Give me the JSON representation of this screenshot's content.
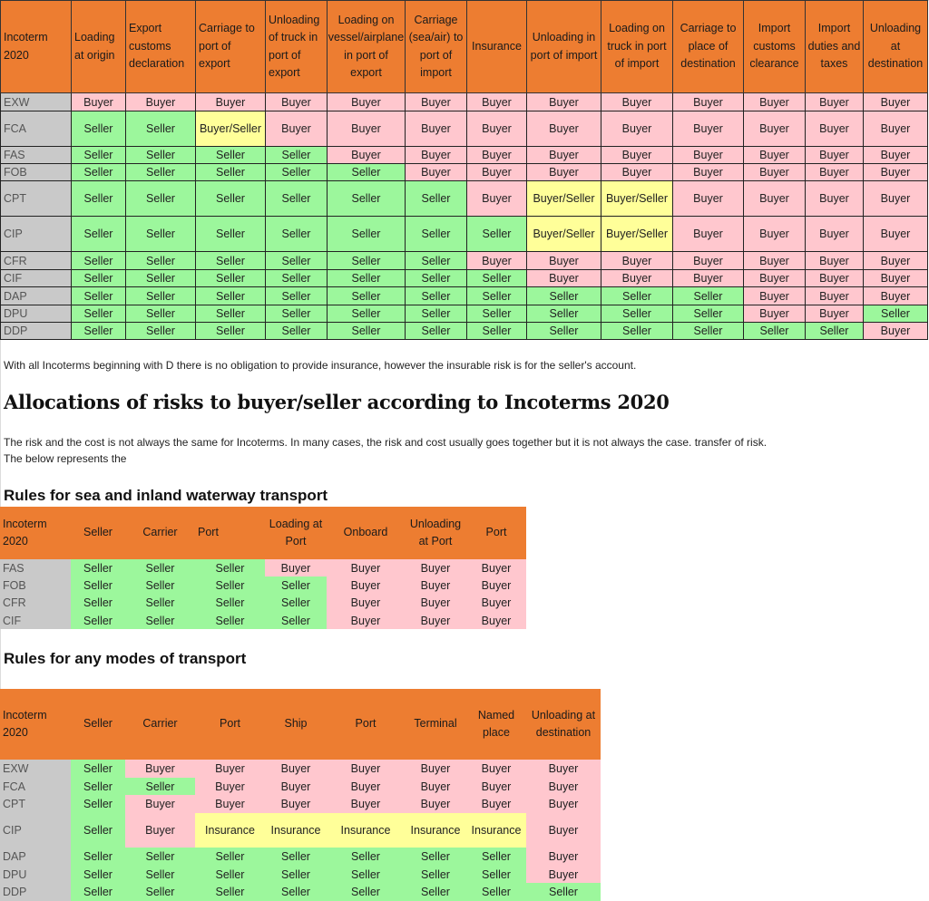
{
  "cost_table": {
    "headers": [
      "Incoterm 2020",
      "Loading at origin",
      "Export customs declaration",
      "Carriage to port of export",
      "Unloading of truck in port of export",
      "Loading on vessel/airplane in port of export",
      "Carriage (sea/air) to port of import",
      "Insurance",
      "Unloading in port of import",
      "Loading on truck in port of import",
      "Carriage to place of destination",
      "Import customs clearance",
      "Import duties and taxes",
      "Unloading at destination"
    ],
    "rows": [
      {
        "term": "EXW",
        "cells": [
          "Buyer",
          "Buyer",
          "Buyer",
          "Buyer",
          "Buyer",
          "Buyer",
          "Buyer",
          "Buyer",
          "Buyer",
          "Buyer",
          "Buyer",
          "Buyer",
          "Buyer"
        ]
      },
      {
        "term": "FCA",
        "cells": [
          "Seller",
          "Seller",
          "Buyer/Seller",
          "Buyer",
          "Buyer",
          "Buyer",
          "Buyer",
          "Buyer",
          "Buyer",
          "Buyer",
          "Buyer",
          "Buyer",
          "Buyer"
        ]
      },
      {
        "term": "FAS",
        "cells": [
          "Seller",
          "Seller",
          "Seller",
          "Seller",
          "Buyer",
          "Buyer",
          "Buyer",
          "Buyer",
          "Buyer",
          "Buyer",
          "Buyer",
          "Buyer",
          "Buyer"
        ]
      },
      {
        "term": "FOB",
        "cells": [
          "Seller",
          "Seller",
          "Seller",
          "Seller",
          "Seller",
          "Buyer",
          "Buyer",
          "Buyer",
          "Buyer",
          "Buyer",
          "Buyer",
          "Buyer",
          "Buyer"
        ]
      },
      {
        "term": "CPT",
        "cells": [
          "Seller",
          "Seller",
          "Seller",
          "Seller",
          "Seller",
          "Seller",
          "Buyer",
          "Buyer/Seller",
          "Buyer/Seller",
          "Buyer",
          "Buyer",
          "Buyer",
          "Buyer"
        ]
      },
      {
        "term": "CIP",
        "cells": [
          "Seller",
          "Seller",
          "Seller",
          "Seller",
          "Seller",
          "Seller",
          "Seller",
          "Buyer/Seller",
          "Buyer/Seller",
          "Buyer",
          "Buyer",
          "Buyer",
          "Buyer"
        ]
      },
      {
        "term": "CFR",
        "cells": [
          "Seller",
          "Seller",
          "Seller",
          "Seller",
          "Seller",
          "Seller",
          "Buyer",
          "Buyer",
          "Buyer",
          "Buyer",
          "Buyer",
          "Buyer",
          "Buyer"
        ]
      },
      {
        "term": "CIF",
        "cells": [
          "Seller",
          "Seller",
          "Seller",
          "Seller",
          "Seller",
          "Seller",
          "Seller",
          "Buyer",
          "Buyer",
          "Buyer",
          "Buyer",
          "Buyer",
          "Buyer"
        ]
      },
      {
        "term": "DAP",
        "cells": [
          "Seller",
          "Seller",
          "Seller",
          "Seller",
          "Seller",
          "Seller",
          "Seller",
          "Seller",
          "Seller",
          "Seller",
          "Buyer",
          "Buyer",
          "Buyer"
        ]
      },
      {
        "term": "DPU",
        "cells": [
          "Seller",
          "Seller",
          "Seller",
          "Seller",
          "Seller",
          "Seller",
          "Seller",
          "Seller",
          "Seller",
          "Seller",
          "Buyer",
          "Buyer",
          "Seller"
        ]
      },
      {
        "term": "DDP",
        "cells": [
          "Seller",
          "Seller",
          "Seller",
          "Seller",
          "Seller",
          "Seller",
          "Seller",
          "Seller",
          "Seller",
          "Seller",
          "Seller",
          "Seller",
          "Buyer"
        ]
      }
    ]
  },
  "notes": {
    "insurance_note": "With all Incoterms beginning with D there is no obligation to provide insurance, however the insurable risk is for the seller's account.",
    "risk_title": "Allocations of risks to buyer/seller according to Incoterms 2020",
    "risk_intro_1": "The risk and the cost is not always the same for Incoterms. In many cases, the risk and cost usually goes together but it is not always the case. transfer of risk.",
    "risk_intro_2": "The below represents the"
  },
  "sea_table": {
    "title": "Rules for sea and inland waterway transport",
    "headers": [
      "Incoterm 2020",
      "Seller",
      "Carrier",
      "Port",
      "Loading at Port",
      "Onboard",
      "Unloading at Port",
      "Port"
    ],
    "rows": [
      {
        "term": "FAS",
        "cells": [
          "Seller",
          "Seller",
          "Seller",
          "Buyer",
          "Buyer",
          "Buyer",
          "Buyer"
        ]
      },
      {
        "term": "FOB",
        "cells": [
          "Seller",
          "Seller",
          "Seller",
          "Seller",
          "Buyer",
          "Buyer",
          "Buyer"
        ]
      },
      {
        "term": "CFR",
        "cells": [
          "Seller",
          "Seller",
          "Seller",
          "Seller",
          "Buyer",
          "Buyer",
          "Buyer"
        ]
      },
      {
        "term": "CIF",
        "cells": [
          "Seller",
          "Seller",
          "Seller",
          "Seller",
          "Buyer",
          "Buyer",
          "Buyer"
        ]
      }
    ]
  },
  "any_table": {
    "title": "Rules for any modes of transport",
    "headers": [
      "Incoterm 2020",
      "Seller",
      "Carrier",
      "Port",
      "Ship",
      "Port",
      "Terminal",
      "Named place",
      "Unloading at destination"
    ],
    "rows": [
      {
        "term": "EXW",
        "cells": [
          "Seller",
          "Buyer",
          "Buyer",
          "Buyer",
          "Buyer",
          "Buyer",
          "Buyer",
          "Buyer"
        ]
      },
      {
        "term": "FCA",
        "cells": [
          "Seller",
          "Seller",
          "Buyer",
          "Buyer",
          "Buyer",
          "Buyer",
          "Buyer",
          "Buyer"
        ]
      },
      {
        "term": "CPT",
        "cells": [
          "Seller",
          "Buyer",
          "Buyer",
          "Buyer",
          "Buyer",
          "Buyer",
          "Buyer",
          "Buyer"
        ]
      },
      {
        "term": "CIP",
        "cells": [
          "Seller",
          "Buyer",
          "Insurance",
          "Insurance",
          "Insurance",
          "Insurance",
          "Insurance",
          "Buyer"
        ]
      },
      {
        "term": "DAP",
        "cells": [
          "Seller",
          "Seller",
          "Seller",
          "Seller",
          "Seller",
          "Seller",
          "Seller",
          "Buyer"
        ]
      },
      {
        "term": "DPU",
        "cells": [
          "Seller",
          "Seller",
          "Seller",
          "Seller",
          "Seller",
          "Seller",
          "Seller",
          "Buyer"
        ]
      },
      {
        "term": "DDP",
        "cells": [
          "Seller",
          "Seller",
          "Seller",
          "Seller",
          "Seller",
          "Seller",
          "Seller",
          "Seller"
        ]
      }
    ]
  },
  "colors": {
    "header": "#ed7d31",
    "buyer": "#ffc7ce",
    "seller": "#9cf79c",
    "mixed": "#ffff99",
    "label": "#c9c9c9"
  }
}
